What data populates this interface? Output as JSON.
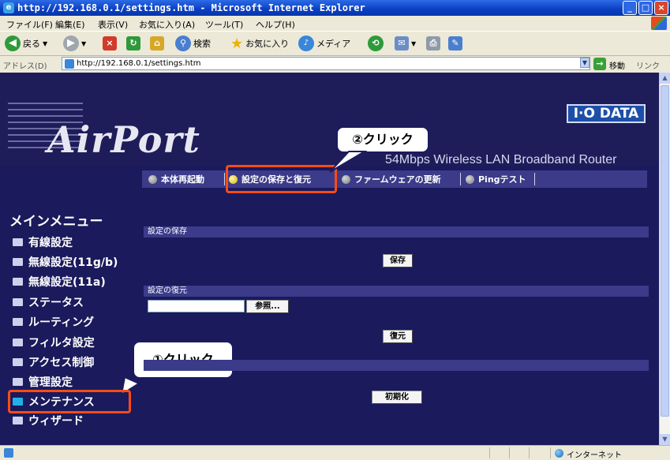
{
  "window": {
    "title": "http://192.168.0.1/settings.htm - Microsoft Internet Explorer",
    "min": "_",
    "max": "□",
    "close": "×"
  },
  "menubar": [
    "ファイル(F)",
    "編集(E)",
    "表示(V)",
    "お気に入り(A)",
    "ツール(T)",
    "ヘルプ(H)"
  ],
  "toolbar": {
    "back_label": "戻る",
    "search_label": "検索",
    "favorites_label": "お気に入り",
    "media_label": "メディア"
  },
  "address": {
    "label": "アドレス(D)",
    "url": "http://192.168.0.1/settings.htm",
    "go_label": "移動",
    "links_label": "リンク"
  },
  "header": {
    "logo_text": "AirPort",
    "brand": "I·O DATA",
    "product_name": "54Mbps Wireless LAN Broadband Router"
  },
  "nav": {
    "items": [
      "本体再起動",
      "設定の保存と復元",
      "ファームウェアの更新",
      "Pingテスト"
    ],
    "active_index": 1
  },
  "sidebar": {
    "title": "メインメニュー",
    "items": [
      "有線設定",
      "無線設定(11g/b)",
      "無線設定(11a)",
      "ステータス",
      "ルーティング",
      "フィルタ設定",
      "アクセス制御",
      "管理設定",
      "メンテナンス",
      "ウィザード"
    ],
    "active_index": 8
  },
  "content": {
    "save_section": "設定の保存",
    "save_button": "保存",
    "restore_section": "設定の復元",
    "browse_button": "参照...",
    "restore_button": "復元",
    "init_button": "初期化"
  },
  "callouts": {
    "step1": "①クリック",
    "step2": "②クリック"
  },
  "statusbar": {
    "zone": "インターネット"
  },
  "colors": {
    "page_bg": "#1a1a5c",
    "nav_bar": "#3b3b8a",
    "highlight": "#ff4b14"
  }
}
